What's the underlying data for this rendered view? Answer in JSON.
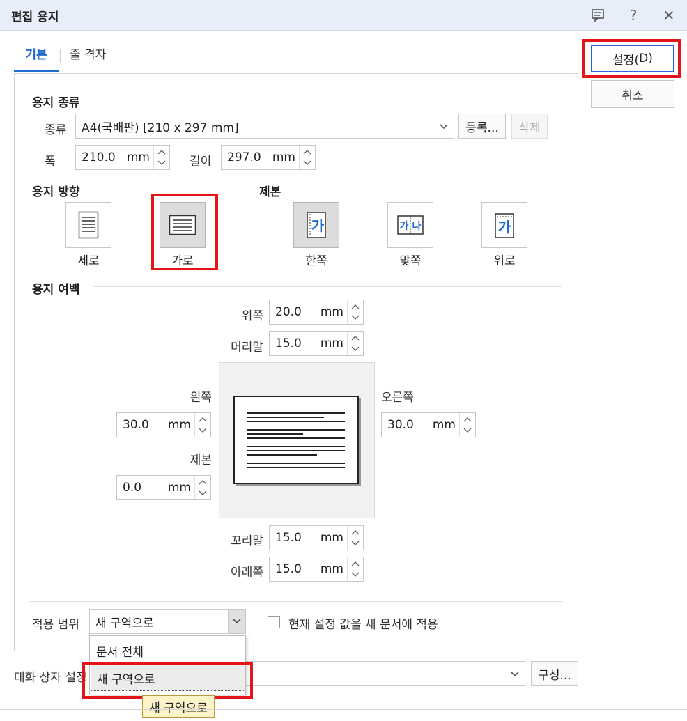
{
  "window": {
    "title": "편집 용지",
    "help_glyph": "?",
    "close_glyph": "✕",
    "icons": [
      "comment-icon",
      "help-icon",
      "close-icon"
    ]
  },
  "tabs": [
    {
      "label": "기본",
      "active": true
    },
    {
      "label": "줄 격자",
      "active": false
    }
  ],
  "actions": {
    "ok_label_prefix": "설정(",
    "ok_mnemonic": "D",
    "ok_label_suffix": ")",
    "cancel_label": "취소"
  },
  "paper_type": {
    "heading": "용지 종류",
    "type_label": "종류",
    "type_value": "A4(국배판)  [210 x 297 mm]",
    "register_label": "등록...",
    "delete_label": "삭제",
    "width_label": "폭",
    "width_value": "210.0",
    "height_label": "길이",
    "height_value": "297.0",
    "unit": "mm"
  },
  "orientation": {
    "heading": "용지 방향",
    "portrait_label": "세로",
    "landscape_label": "가로",
    "selected": "가로"
  },
  "binding": {
    "heading": "제본",
    "single_label": "한쪽",
    "facing_label": "맞쪽",
    "top_label": "위로",
    "glyph_ga": "가",
    "glyph_na": "나",
    "selected": "한쪽"
  },
  "margins": {
    "heading": "용지 여백",
    "top_label": "위쪽",
    "top_value": "20.0",
    "header_label": "머리말",
    "header_value": "15.0",
    "left_label": "왼쪽",
    "left_value": "30.0",
    "right_label": "오른쪽",
    "right_value": "30.0",
    "gutter_label": "제본",
    "gutter_value": "0.0",
    "footer_label": "꼬리말",
    "footer_value": "15.0",
    "bottom_label": "아래쪽",
    "bottom_value": "15.0",
    "unit": "mm"
  },
  "apply": {
    "label": "적용 범위",
    "value": "새 구역으로",
    "options": [
      "문서 전체",
      "새 구역으로"
    ],
    "highlighted_option": "새 구역으로",
    "tooltip": "새 구역으로",
    "new_doc_checkbox_label": "현재 설정 값을 새 문서에 적용",
    "new_doc_checked": false
  },
  "dialog_settings": {
    "label": "대화 상자 설정",
    "configure_label": "구성..."
  },
  "colors": {
    "accent": "#1f6ad1",
    "highlight_box": "#e4141b",
    "title_bar": "#e7eef9",
    "tooltip_bg": "#fdf3c8"
  }
}
